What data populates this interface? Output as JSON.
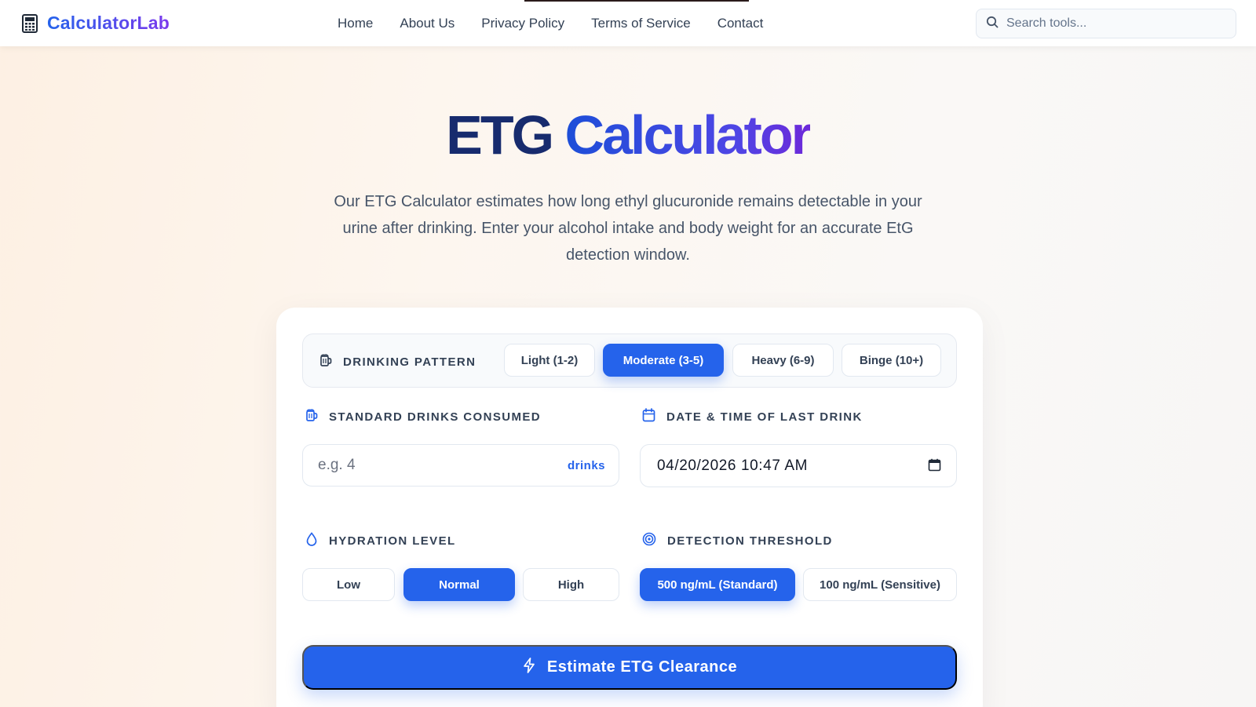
{
  "header": {
    "logo_text": "CalculatorLab",
    "nav": [
      "Home",
      "About Us",
      "Privacy Policy",
      "Terms of Service",
      "Contact"
    ],
    "search_placeholder": "Search tools..."
  },
  "hero": {
    "title_part1": "ETG",
    "title_part2": "Calculator",
    "description": "Our ETG Calculator estimates how long ethyl glucuronide remains detectable in your urine after drinking. Enter your alcohol intake and body weight for an accurate EtG detection window."
  },
  "form": {
    "drinking_pattern": {
      "label": "DRINKING PATTERN",
      "options": [
        "Light (1-2)",
        "Moderate (3-5)",
        "Heavy (6-9)",
        "Binge (10+)"
      ],
      "selected": "Moderate (3-5)"
    },
    "standard_drinks": {
      "label": "STANDARD DRINKS CONSUMED",
      "placeholder": "e.g. 4",
      "unit": "drinks"
    },
    "last_drink": {
      "label": "DATE & TIME OF LAST DRINK",
      "value": "04/20/2026 10:47 AM"
    },
    "hydration": {
      "label": "HYDRATION LEVEL",
      "options": [
        "Low",
        "Normal",
        "High"
      ],
      "selected": "Normal"
    },
    "threshold": {
      "label": "DETECTION THRESHOLD",
      "options": [
        "500 ng/mL (Standard)",
        "100 ng/mL (Sensitive)"
      ],
      "selected": "500 ng/mL (Standard)"
    },
    "submit_label": "Estimate ETG Clearance"
  },
  "colors": {
    "accent": "#2563eb",
    "title_dark": "#172b6e",
    "text_muted": "#475569"
  },
  "icons": {
    "logo": "calculator-icon",
    "search": "search-icon",
    "pattern": "beer-mug-icon",
    "drinks": "beer-mug-icon",
    "date": "calendar-icon",
    "hydration": "water-drop-icon",
    "threshold": "target-icon",
    "submit": "lightning-icon"
  }
}
